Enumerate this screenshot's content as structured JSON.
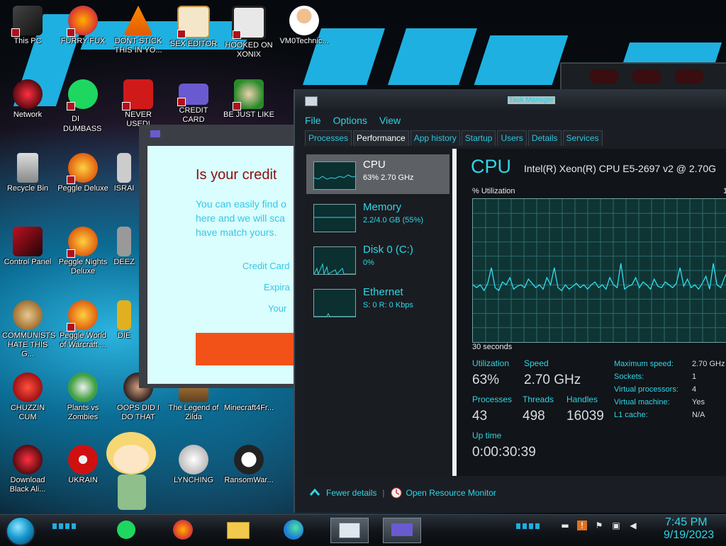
{
  "desktop": {
    "icons": [
      {
        "label": "This PC"
      },
      {
        "label": "FURRY FUX"
      },
      {
        "label": "DONT STICK\nTHIS IN YO..."
      },
      {
        "label": "SEX EDITOR"
      },
      {
        "label": "HOOKED ON\nXONIX"
      },
      {
        "label": "VM0Technic..."
      },
      {
        "label": "Network"
      },
      {
        "label": "DI"
      },
      {
        "label": "DUMBASS"
      },
      {
        "label": "NEVER USED!"
      },
      {
        "label": "CREDIT CARD"
      },
      {
        "label": "BE JUST LIKE"
      },
      {
        "label": "Recycle Bin"
      },
      {
        "label": "Peggle Deluxe"
      },
      {
        "label": "ISRAI"
      },
      {
        "label": "Control Panel"
      },
      {
        "label": "Peggle Nights\nDeluxe"
      },
      {
        "label": "DEEZ"
      },
      {
        "label": "COMMUNISTS\nHATE THIS G..."
      },
      {
        "label": "Peggle World\nof Warcraft ..."
      },
      {
        "label": "DIE"
      },
      {
        "label": "CHUZZIN\nCUM"
      },
      {
        "label": "Plants vs\nZombies"
      },
      {
        "label": "OOPS DID I\nDO THAT"
      },
      {
        "label": "The Legend of\nZilda"
      },
      {
        "label": "Minecraft4Fr..."
      },
      {
        "label": "Download\nBlack Ali..."
      },
      {
        "label": "UKRAIN"
      },
      {
        "label": "LYNCHING"
      },
      {
        "label": "RansomWar..."
      }
    ]
  },
  "credit_card_window": {
    "title": "Is your credit",
    "intro_lines": [
      "You can easily find o",
      "here and we will sca",
      "have match yours."
    ],
    "field_labels": [
      "Credit Card",
      "Expira",
      "Your"
    ]
  },
  "task_manager": {
    "title": "Task Manager",
    "menu": [
      "File",
      "Options",
      "View"
    ],
    "tabs": [
      "Processes",
      "Performance",
      "App history",
      "Startup",
      "Users",
      "Details",
      "Services"
    ],
    "active_tab": "Performance",
    "resources": [
      {
        "name": "CPU",
        "value": "63%  2.70 GHz"
      },
      {
        "name": "Memory",
        "value": "2.2/4.0 GB (55%)"
      },
      {
        "name": "Disk 0 (C:)",
        "value": "0%"
      },
      {
        "name": "Ethernet",
        "value": "S: 0 R: 0 Kbps"
      }
    ],
    "cpu": {
      "heading": "CPU",
      "model": "Intel(R) Xeon(R) CPU E5-2697 v2 @ 2.70G",
      "graph_label": "% Utilization",
      "graph_max": "1",
      "graph_time": "30 seconds",
      "utilization_label": "Utilization",
      "utilization": "63%",
      "speed_label": "Speed",
      "speed": "2.70 GHz",
      "processes_label": "Processes",
      "processes": "43",
      "threads_label": "Threads",
      "threads": "498",
      "handles_label": "Handles",
      "handles": "16039",
      "uptime_label": "Up time",
      "uptime": "0:00:30:39",
      "specs": [
        {
          "label": "Maximum speed:",
          "value": "2.70 GHz"
        },
        {
          "label": "Sockets:",
          "value": "1"
        },
        {
          "label": "Virtual processors:",
          "value": "4"
        },
        {
          "label": "Virtual machine:",
          "value": "Yes"
        },
        {
          "label": "L1 cache:",
          "value": "N/A"
        }
      ],
      "history": [
        40,
        38,
        40,
        36,
        41,
        52,
        38,
        36,
        42,
        40,
        45,
        37,
        39,
        40,
        38,
        44,
        41,
        38,
        40,
        37,
        45,
        40,
        52,
        38,
        36,
        40,
        37,
        39,
        41,
        38,
        40,
        37,
        40,
        42,
        38,
        40,
        37,
        45,
        40,
        38,
        55,
        37,
        39,
        40,
        45,
        38,
        42,
        40,
        37,
        44,
        39,
        38,
        42,
        40,
        38,
        41,
        52,
        39,
        44,
        38,
        40,
        37,
        41,
        46,
        37,
        55,
        40,
        38,
        45,
        50
      ]
    },
    "footer": {
      "fewer_details": "Fewer details",
      "resource_monitor": "Open Resource Monitor"
    }
  },
  "taskbar": {
    "time": "7:45 PM",
    "date": "9/19/2023"
  }
}
